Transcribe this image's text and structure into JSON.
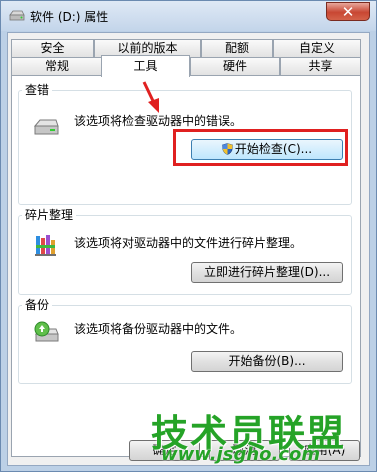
{
  "window": {
    "title": "软件 (D:) 属性",
    "close_label": "✕"
  },
  "tabs_row1": [
    "安全",
    "以前的版本",
    "配额",
    "自定义"
  ],
  "tabs_row2": [
    "常规",
    "工具",
    "硬件",
    "共享"
  ],
  "active_tab": "工具",
  "groups": {
    "error_check": {
      "title": "查错",
      "description": "该选项将检查驱动器中的错误。",
      "button": "开始检查(C)..."
    },
    "defrag": {
      "title": "碎片整理",
      "description": "该选项将对驱动器中的文件进行碎片整理。",
      "button": "立即进行碎片整理(D)..."
    },
    "backup": {
      "title": "备份",
      "description": "该选项将备份驱动器中的文件。",
      "button": "开始备份(B)..."
    }
  },
  "footer": {
    "ok": "确定",
    "cancel": "取消",
    "apply": "应用(A)"
  },
  "watermark": {
    "text": "技术员联盟",
    "url": "www.jsgho.com"
  },
  "colors": {
    "highlight_box": "#e02020",
    "watermark": "#25a327"
  }
}
